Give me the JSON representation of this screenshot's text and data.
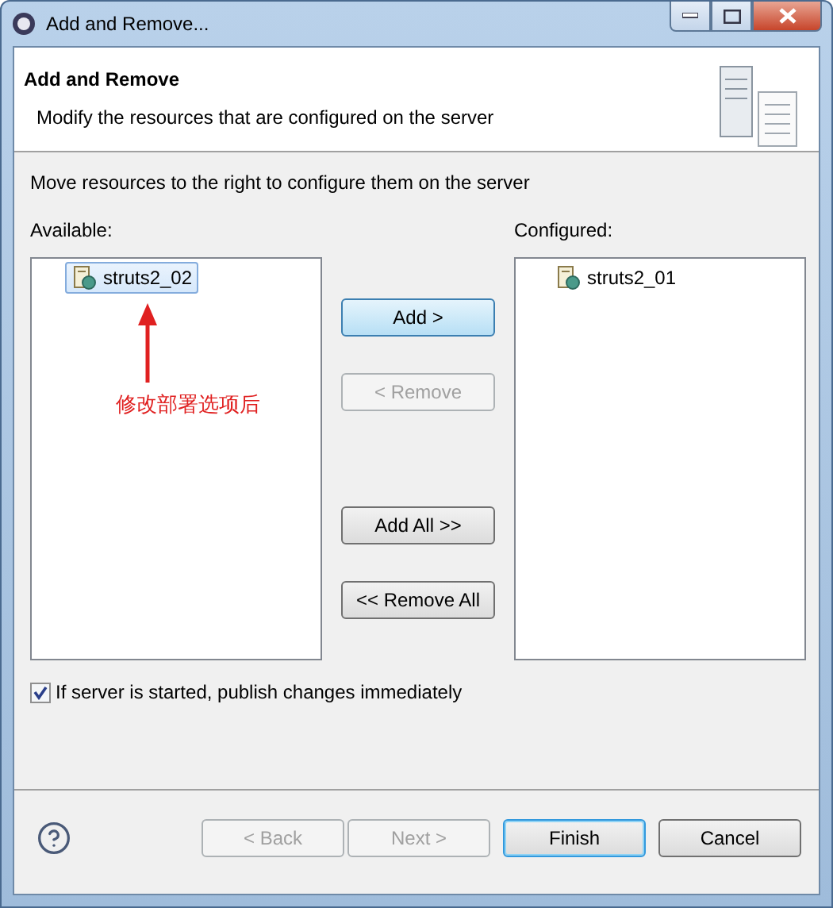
{
  "window": {
    "title": "Add and Remove..."
  },
  "header": {
    "title": "Add and Remove",
    "description": "Modify the resources that are configured on the server"
  },
  "instruction": "Move resources to the right to configure them on the server",
  "available": {
    "label": "Available:",
    "items": [
      {
        "name": "struts2_02",
        "selected": true
      }
    ]
  },
  "configured": {
    "label": "Configured:",
    "items": [
      {
        "name": "struts2_01",
        "selected": false
      }
    ]
  },
  "annotation": "修改部署选项后",
  "move_buttons": [
    {
      "label": "Add >",
      "disabled": false,
      "highlighted": true
    },
    {
      "label": "< Remove",
      "disabled": true,
      "highlighted": false
    },
    {
      "label": "Add All >>",
      "disabled": false,
      "highlighted": false
    },
    {
      "label": "<< Remove All",
      "disabled": false,
      "highlighted": false
    }
  ],
  "publish": {
    "label": "If server is started, publish changes immediately",
    "checked": true
  },
  "footer_buttons": [
    {
      "label": "< Back",
      "disabled": true,
      "default": false
    },
    {
      "label": "Next >",
      "disabled": true,
      "default": false
    },
    {
      "label": "Finish",
      "disabled": false,
      "default": true
    },
    {
      "label": "Cancel",
      "disabled": false,
      "default": false
    }
  ]
}
